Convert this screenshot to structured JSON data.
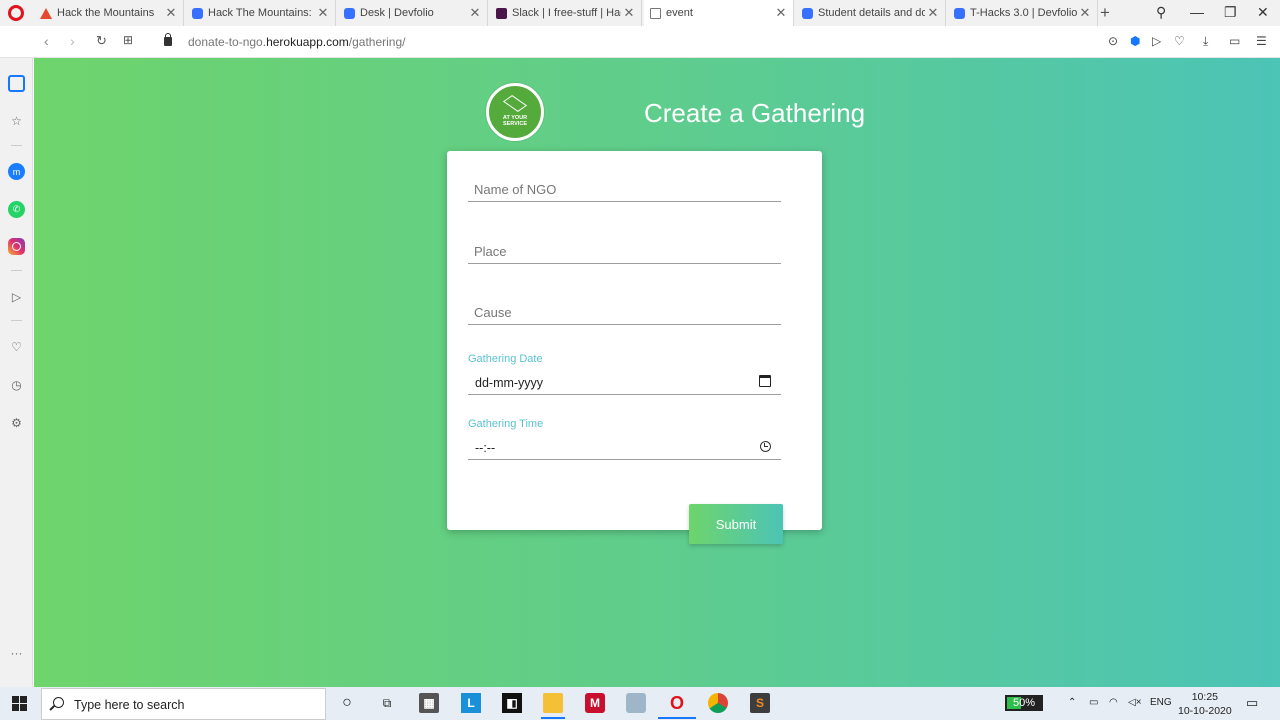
{
  "browser": {
    "tabs": [
      {
        "title": "Hack the Mountains",
        "icon": "htm"
      },
      {
        "title": "Hack The Mountains: De",
        "icon": "devfolio"
      },
      {
        "title": "Desk | Devfolio",
        "icon": "devfolio"
      },
      {
        "title": "Slack | I free-stuff | Hack",
        "icon": "slack"
      },
      {
        "title": "event",
        "icon": "doc",
        "active": true
      },
      {
        "title": "Student details and doc",
        "icon": "devfolio"
      },
      {
        "title": "T-Hacks 3.0 | Devfolio",
        "icon": "devfolio"
      }
    ],
    "url": {
      "prefix": "donate-to-ngo.",
      "host": "herokuapp.com",
      "path": "/gathering/"
    }
  },
  "page": {
    "logo_text": [
      "AT YOUR",
      "SERVICE"
    ],
    "heading": "Create a Gathering",
    "form": {
      "ngo_placeholder": "Name of NGO",
      "place_placeholder": "Place",
      "cause_placeholder": "Cause",
      "date_label": "Gathering Date",
      "date_value": "dd-mm-yyyy",
      "time_label": "Gathering Time",
      "time_value": "--:--",
      "submit_label": "Submit"
    }
  },
  "taskbar": {
    "search_placeholder": "Type here to search",
    "battery": "50%",
    "language": "ENG",
    "time": "10:25",
    "date": "10-10-2020"
  },
  "colors": {
    "gradient_start": "#6ed46c",
    "gradient_end": "#4cc4b6",
    "label_accent": "#5bc0d4"
  }
}
